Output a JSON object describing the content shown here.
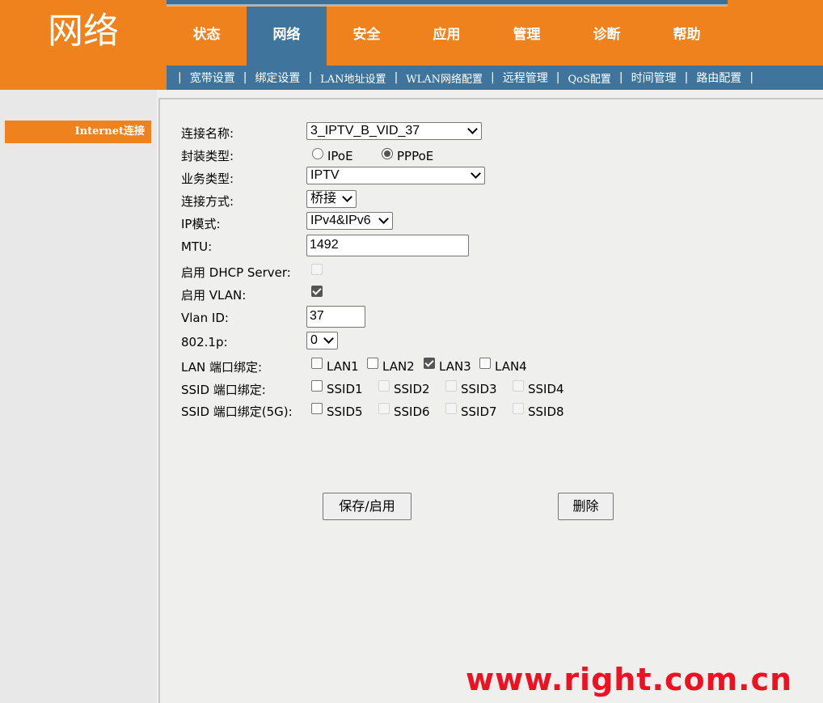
{
  "header": {
    "title": "网络",
    "main_nav": [
      {
        "label": "状态",
        "active": false
      },
      {
        "label": "网络",
        "active": true
      },
      {
        "label": "安全",
        "active": false
      },
      {
        "label": "应用",
        "active": false
      },
      {
        "label": "管理",
        "active": false
      },
      {
        "label": "诊断",
        "active": false
      },
      {
        "label": "帮助",
        "active": false
      }
    ],
    "sub_nav": [
      "宽带设置",
      "绑定设置",
      "LAN地址设置",
      "WLAN网络配置",
      "远程管理",
      "QoS配置",
      "时间管理",
      "路由配置"
    ],
    "separator": "|"
  },
  "sidebar": {
    "item": "Internet连接"
  },
  "form": {
    "connection_name": {
      "label": "连接名称:",
      "value": "3_IPTV_B_VID_37"
    },
    "encapsulation": {
      "label": "封装类型:",
      "options": [
        "IPoE",
        "PPPoE"
      ],
      "selected": "PPPoE"
    },
    "service_type": {
      "label": "业务类型:",
      "value": "IPTV"
    },
    "connection_mode": {
      "label": "连接方式:",
      "value": "桥接"
    },
    "ip_mode": {
      "label": "IP模式:",
      "value": "IPv4&IPv6"
    },
    "mtu": {
      "label": "MTU:",
      "value": "1492"
    },
    "dhcp_server": {
      "label": "启用 DHCP Server:",
      "checked": false,
      "disabled": true
    },
    "vlan": {
      "label": "启用 VLAN:",
      "checked": true
    },
    "vlan_id": {
      "label": "Vlan ID:",
      "value": "37"
    },
    "dot1p": {
      "label": "802.1p:",
      "value": "0"
    },
    "lan_binding": {
      "label": "LAN 端口绑定:",
      "items": [
        {
          "name": "LAN1",
          "checked": false
        },
        {
          "name": "LAN2",
          "checked": false
        },
        {
          "name": "LAN3",
          "checked": true
        },
        {
          "name": "LAN4",
          "checked": false
        }
      ]
    },
    "ssid_binding": {
      "label": "SSID 端口绑定:",
      "items": [
        {
          "name": "SSID1",
          "checked": false,
          "disabled": false
        },
        {
          "name": "SSID2",
          "checked": false,
          "disabled": true
        },
        {
          "name": "SSID3",
          "checked": false,
          "disabled": true
        },
        {
          "name": "SSID4",
          "checked": false,
          "disabled": true
        }
      ]
    },
    "ssid5g_binding": {
      "label": "SSID 端口绑定(5G):",
      "items": [
        {
          "name": "SSID5",
          "checked": false,
          "disabled": false
        },
        {
          "name": "SSID6",
          "checked": false,
          "disabled": true
        },
        {
          "name": "SSID7",
          "checked": false,
          "disabled": true
        },
        {
          "name": "SSID8",
          "checked": false,
          "disabled": true
        }
      ]
    }
  },
  "buttons": {
    "save": "保存/启用",
    "delete": "删除"
  },
  "watermark": "www.right.com.cn",
  "colors": {
    "orange": "#f0821e",
    "nav_blue": "#3f759c",
    "watermark_red": "#ee1122"
  }
}
